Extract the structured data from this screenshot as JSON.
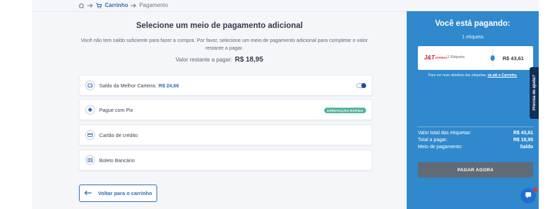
{
  "breadcrumb": {
    "cart": "Carrinho",
    "payment": "Pagamento"
  },
  "main": {
    "title": "Selecione um meio de pagamento adicional",
    "description": "Você não tem saldo suficiente para fazer a compra. Por favor, selecione um meio de pagamento adicional para completar o valor restante a pagar.",
    "remaining_label": "Valor restante a pagar:",
    "remaining_value": "R$ 18,95"
  },
  "options": [
    {
      "label": "Saldo da Melhor Carteira:",
      "value": "R$ 24,66",
      "icon": "wallet-icon",
      "toggle_on": true
    },
    {
      "label": "Pague com Pix",
      "badge": "APROVAÇÃO RÁPIDA",
      "icon": "pix-icon"
    },
    {
      "label": "Cartão de crédito",
      "icon": "credit-card-icon"
    },
    {
      "label": "Boleto Bancário",
      "icon": "barcode-icon"
    }
  ],
  "back_button": "Voltar para o carrinho",
  "summary": {
    "title": "Você está pagando:",
    "count": "1 etiqueta",
    "carrier_logo": "J&T",
    "carrier_logo_sub": "EXPRESS",
    "item_label": "1 Etiqueta",
    "item_price": "R$ 43,61",
    "note": "Para ver mais detalhes das etiquetas,",
    "note_link": "vá até o Carrinho.",
    "total_labels_label": "Valor total das etiquetas:",
    "total_labels_value": "R$ 43,61",
    "total_pay_label": "Total a pagar:",
    "total_pay_value": "R$ 18,95",
    "method_label": "Meio de pagamento:",
    "method_value": "Saldo",
    "pay_button": "PAGAR AGORA"
  },
  "help_tab": "Precisa de ajuda?",
  "colors": {
    "accent": "#2f89cc",
    "link": "#2f6eb5",
    "badge": "#52b59b",
    "pay_button": "#616b77"
  }
}
